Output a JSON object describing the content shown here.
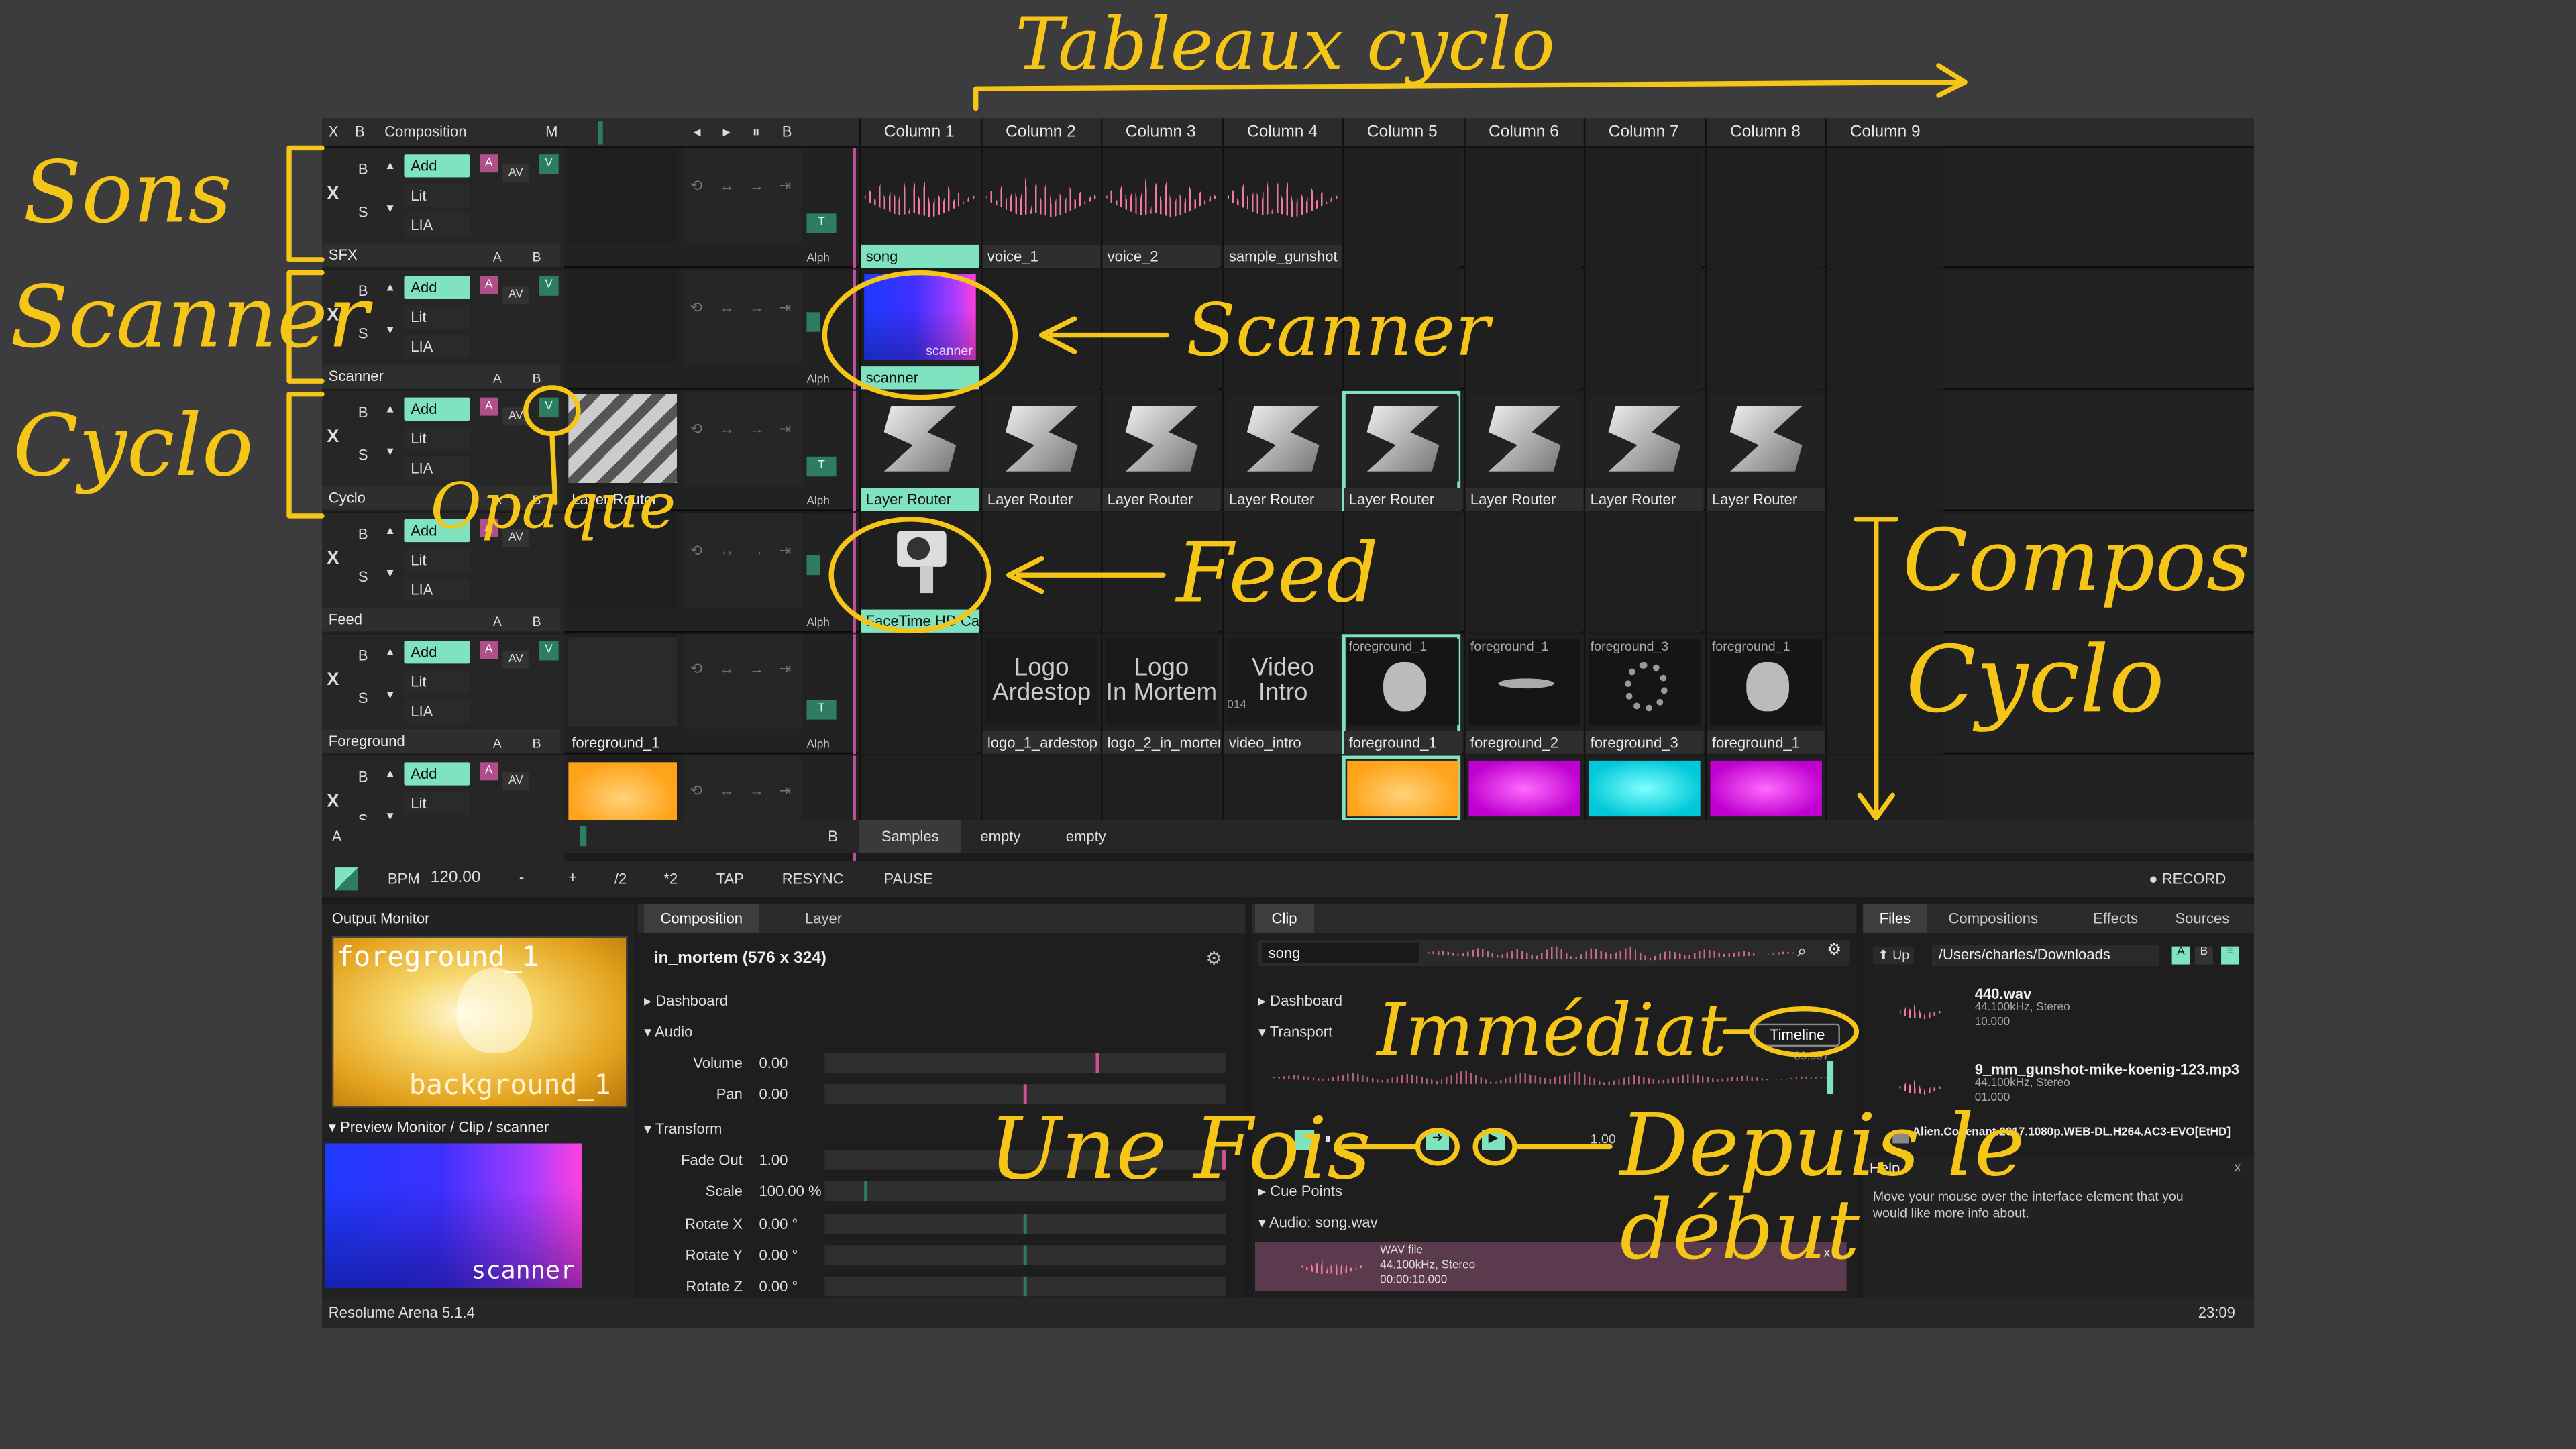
{
  "header": {
    "x": "X",
    "b": "B",
    "composition": "Composition",
    "m": "M",
    "transport_glyphs": [
      "◂",
      "▸",
      "⏸",
      "B"
    ],
    "columns": [
      "Column 1",
      "Column 2",
      "Column 3",
      "Column 4",
      "Column 5",
      "Column 6",
      "Column 7",
      "Column 8",
      "Column 9"
    ]
  },
  "layer_controls": {
    "b": "B",
    "s": "S",
    "x": "X",
    "up": "▲",
    "down": "▼",
    "blend_default": "Add",
    "mode2": "Lit",
    "mode3": "LIA",
    "pink": "A",
    "av": "AV",
    "v": "V",
    "t": "T",
    "alph": "Alph",
    "a": "A",
    "b2": "B"
  },
  "layers": [
    {
      "name": "SFX",
      "clips": [
        "song",
        "voice_1",
        "voice_2",
        "sample_gunshot",
        "",
        "",
        "",
        "",
        ""
      ]
    },
    {
      "name": "Scanner",
      "clips": [
        "scanner",
        "",
        "",
        "",
        "",
        "",
        "",
        "",
        ""
      ]
    },
    {
      "name": "Cyclo",
      "layer_clip": "Layer Router",
      "clips": [
        "Layer Router",
        "Layer Router",
        "Layer Router",
        "Layer Router",
        "Layer Router",
        "Layer Router",
        "Layer Router",
        "Layer Router",
        ""
      ]
    },
    {
      "name": "Feed",
      "clips": [
        "FaceTime HD Ca...",
        "",
        "",
        "",
        "",
        "",
        "",
        "",
        ""
      ]
    },
    {
      "name": "Foreground",
      "layer_clip": "foreground_1",
      "clips": [
        "",
        "logo_1_ardestop",
        "logo_2_in_mortem",
        "video_intro",
        "foreground_1",
        "foreground_2",
        "foreground_3",
        "foreground_1",
        ""
      ]
    },
    {
      "name": "",
      "clips": [
        "",
        "",
        "",
        "",
        "",
        "",
        "",
        "",
        ""
      ]
    }
  ],
  "clip_thumb_text": {
    "scanner": "scanner",
    "logo1_line1": "Logo",
    "logo1_line2": "Ardestop",
    "logo2_line1": "Logo",
    "logo2_line2": "In Mortem",
    "video_line1": "Video",
    "video_line2": "Intro",
    "video_num": "014",
    "fg": "foreground_1",
    "fg2": "foreground_1",
    "fg3": "foreground_3",
    "fg4": "foreground_1",
    "fg_layer": "foreground_1"
  },
  "deck_bar": {
    "a": "A",
    "b": "B",
    "decks": [
      "Samples",
      "empty",
      "empty"
    ]
  },
  "tempo_bar": {
    "bpm_label": "BPM",
    "bpm_value": "120.00",
    "minus": "-",
    "plus": "+",
    "half": "/2",
    "double": "*2",
    "tap": "TAP",
    "resync": "RESYNC",
    "pause": "PAUSE",
    "record": "● RECORD"
  },
  "output_monitor": {
    "title": "Output Monitor",
    "overlay_top": "foreground_1",
    "overlay_bottom": "background_1"
  },
  "preview_monitor": {
    "title": "Preview Monitor / Clip / scanner",
    "overlay": "scanner"
  },
  "composition_panel": {
    "tabs": [
      "Composition",
      "Layer"
    ],
    "title": "in_mortem (576 x 324)",
    "sections": {
      "dashboard": "Dashboard",
      "audio": "Audio",
      "transform": "Transform"
    },
    "params": [
      {
        "label": "Volume",
        "value": "0.00",
        "knob": 0.68
      },
      {
        "label": "Pan",
        "value": "0.00",
        "knob": 0.5
      },
      {
        "label": "Fade Out",
        "value": "1.00",
        "knob": 1.0
      },
      {
        "label": "Scale",
        "value": "100.00 %",
        "knob": 0.1
      },
      {
        "label": "Rotate X",
        "value": "0.00 °",
        "knob": 0.5
      },
      {
        "label": "Rotate Y",
        "value": "0.00 °",
        "knob": 0.5
      },
      {
        "label": "Rotate Z",
        "value": "0.00 °",
        "knob": 0.5
      }
    ]
  },
  "clip_panel": {
    "tab": "Clip",
    "search_value": "song",
    "dashboard": "Dashboard",
    "transport": "Transport",
    "timeline_label": "Timeline",
    "timeline_end": "09.997",
    "speed_value": "1.00",
    "cue_points": "Cue Points",
    "audio_title": "Audio: song.wav",
    "file_type": "WAV file",
    "file_rate": "44.100kHz, Stereo",
    "file_duration": "00:00:10.000"
  },
  "files_panel": {
    "tabs": [
      "Files",
      "Compositions",
      "Effects",
      "Sources"
    ],
    "up": "⬆ Up",
    "path": "/Users/charles/Downloads",
    "files": [
      {
        "name": "440.wav",
        "info": "44.100kHz, Stereo",
        "dur": "10.000"
      },
      {
        "name": "9_mm_gunshot-mike-koenig-123.mp3",
        "info": "44.100kHz, Stereo",
        "dur": "01.000"
      },
      {
        "name": "Alien.Covenant.2017.1080p.WEB-DL.H264.AC3-EVO[EtHD]",
        "info": "",
        "dur": ""
      }
    ],
    "help_title": "Help",
    "help_text": "Move your mouse over the interface element that you would like more info about."
  },
  "status_bar": {
    "app": "Resolume Arena 5.1.4",
    "time": "23:09"
  },
  "annotations": {
    "tableaux": "Tableaux cyclo",
    "sons": "Sons",
    "scanner_left": "Scanner",
    "cyclo_left": "Cyclo",
    "scanner_arrow": "Scanner",
    "opaque": "Opaque",
    "feed": "Feed",
    "compos": "Compos",
    "cyclo_right": "Cyclo",
    "immediat": "Immédiat",
    "une_fois": "Une Fois",
    "depuis": "Depuis le",
    "debut": "début"
  },
  "colors": {
    "accent_green": "#7fe3bf",
    "annotation_yellow": "#f5c518",
    "waveform_pink": "#f27aa0",
    "layer_pink": "#b0508a"
  }
}
